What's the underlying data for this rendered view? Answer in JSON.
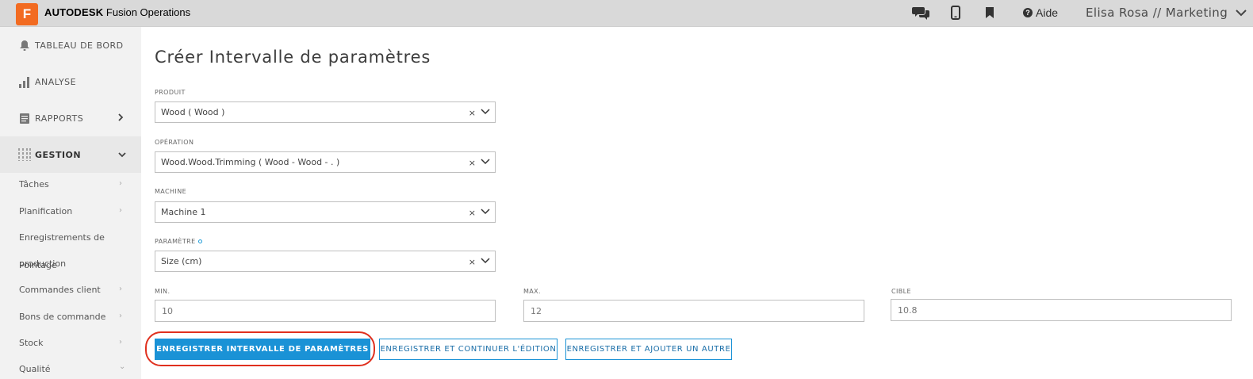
{
  "header": {
    "logo_letter": "F",
    "brand_bold": "AUTODESK",
    "brand_rest": " Fusion Operations",
    "help_label": "Aide",
    "user_label": "Elisa Rosa // Marketing",
    "icons": [
      "chat-icon",
      "mobile-icon",
      "bookmark-icon",
      "help-icon",
      "chevron-down-icon"
    ]
  },
  "sidebar": {
    "main_items": [
      {
        "label": "TABLEAU DE BORD",
        "icon": "bell-icon"
      },
      {
        "label": "ANALYSE",
        "icon": "bar-chart-icon"
      },
      {
        "label": "RAPPORTS",
        "icon": "report-icon",
        "chevron": "›"
      },
      {
        "label": "GESTION",
        "icon": "sliders-icon",
        "chevron": "⌄"
      }
    ],
    "sub_items": [
      {
        "label": "Tâches"
      },
      {
        "label": "Planification"
      },
      {
        "label": "Enregistrements de"
      },
      {
        "label": "production"
      },
      {
        "label": "Pointage"
      },
      {
        "label": "Commandes client"
      },
      {
        "label": "Bons de commande"
      },
      {
        "label": "Stock"
      },
      {
        "label": "Qualité"
      }
    ]
  },
  "form": {
    "title": "Créer Intervalle de paramètres",
    "produit_label": "PRODUIT",
    "produit_value": "Wood ( Wood )",
    "operation_label": "OPÉRATION",
    "operation_value": "Wood.Wood.Trimming ( Wood - Wood - . )",
    "machine_label": "MACHINE",
    "machine_value": "Machine 1",
    "parametre_label": "PARAMÈTRE",
    "parametre_value": "Size (cm)",
    "clear_glyph": "×",
    "min_label": "MIN.",
    "min_value": "10",
    "max_label": "MAX.",
    "max_value": "12",
    "cible_label": "CIBLE",
    "cible_value": "10.8"
  },
  "buttons": {
    "save_label": "ENREGISTRER INTERVALLE DE PARAMÈTRES",
    "save_continue_label": "ENREGISTRER ET CONTINUER L'ÉDITION",
    "save_add_label": "ENREGISTRER ET AJOUTER UN AUTRE"
  },
  "colors": {
    "accent": "#1a92d6",
    "logo": "#f26b21",
    "highlight": "#e0301e"
  }
}
